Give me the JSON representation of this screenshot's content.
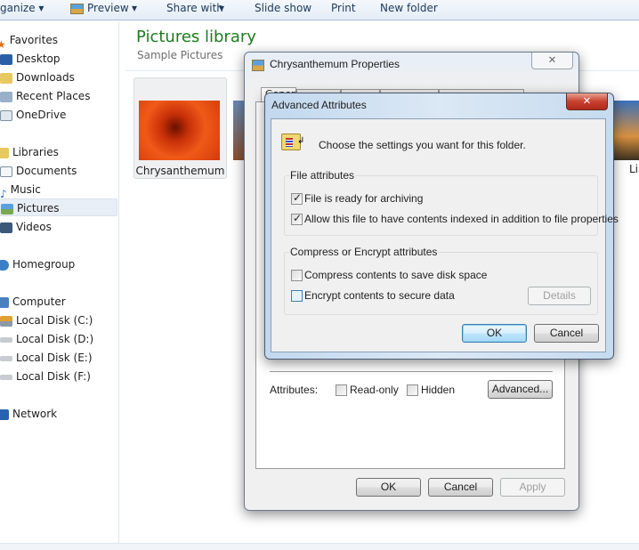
{
  "toolbar": {
    "organize": "ganize ▾",
    "preview": "Preview",
    "share_with": "Share with",
    "slide_show": "Slide show",
    "print": "Print",
    "new_folder": "New folder"
  },
  "sidebar": {
    "favorites": "Favorites",
    "desktop": "Desktop",
    "downloads": "Downloads",
    "recent_places": "Recent Places",
    "onedrive": "OneDrive",
    "libraries": "Libraries",
    "documents": "Documents",
    "music": "Music",
    "pictures": "Pictures",
    "videos": "Videos",
    "homegroup": "Homegroup",
    "computer": "Computer",
    "disk_c": "Local Disk (C:)",
    "disk_d": "Local Disk (D:)",
    "disk_e": "Local Disk (E:)",
    "disk_f": "Local Disk (F:)",
    "network": "Network"
  },
  "library": {
    "title": "Pictures library",
    "subtitle": "Sample Pictures",
    "items": [
      {
        "label": "Chrysanthemum"
      },
      {
        "label": "Li"
      }
    ],
    "title_color": "#1e7b1e"
  },
  "properties": {
    "title": "Chrysanthemum Properties",
    "tab_general": "General",
    "attributes_label": "Attributes:",
    "readonly": "Read-only",
    "hidden": "Hidden",
    "advanced": "Advanced...",
    "ok": "OK",
    "cancel": "Cancel",
    "apply": "Apply"
  },
  "advanced": {
    "title": "Advanced Attributes",
    "intro": "Choose the settings you want for this folder.",
    "file_group": "File attributes",
    "archive": "File is ready for archiving",
    "archive_checked": true,
    "index": "Allow this file to have contents indexed in addition to file properties",
    "index_checked": true,
    "compress_group": "Compress or Encrypt attributes",
    "compress": "Compress contents to save disk space",
    "compress_checked": false,
    "encrypt": "Encrypt contents to secure data",
    "encrypt_checked": false,
    "details": "Details",
    "ok": "OK",
    "cancel": "Cancel"
  }
}
